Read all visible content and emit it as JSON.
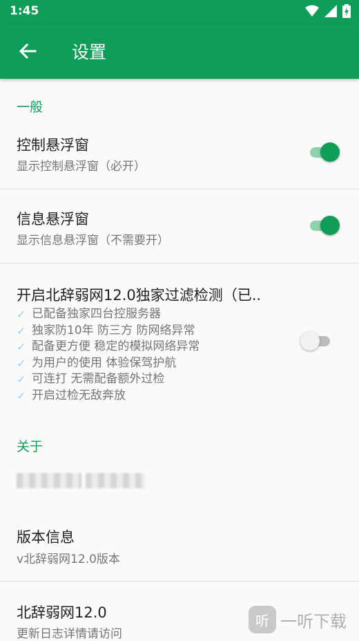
{
  "status_bar": {
    "time": "1:45",
    "icons": [
      "wifi-icon",
      "signal-icon",
      "battery-charging-icon"
    ]
  },
  "toolbar": {
    "title": "设置",
    "back_icon": "arrow-back-icon",
    "color": "#0f9d58"
  },
  "sections": {
    "general": {
      "header": "一般",
      "control_float": {
        "title": "控制悬浮窗",
        "summary": "显示控制悬浮窗（必开）",
        "enabled": true
      },
      "info_float": {
        "title": "信息悬浮窗",
        "summary": "显示信息悬浮窗（不需要开）",
        "enabled": true
      },
      "filter_detect": {
        "title": "开启北辞弱网12.0独家过滤检测（已..",
        "enabled": false,
        "features": [
          "已配备独家四台控服务器",
          "独家防10年 防三方 防网络异常",
          "配备更方便 稳定的模拟网络异常",
          "为用户的使用 体验保驾护航",
          "可连打 无需配备额外过检",
          "开启过检无敌奔放"
        ]
      }
    },
    "about": {
      "header": "关于",
      "version": {
        "title": "版本信息",
        "summary": "v北辞弱网12.0版本"
      },
      "app": {
        "title": "北辞弱网12.0",
        "summary": "更新日志详情请访问"
      }
    }
  },
  "watermark": {
    "logo_text": "听",
    "text": "一听下载"
  },
  "colors": {
    "accent": "#0f9d58",
    "switch_track_on": "#8fd3ad",
    "check": "#9ad0ee"
  }
}
